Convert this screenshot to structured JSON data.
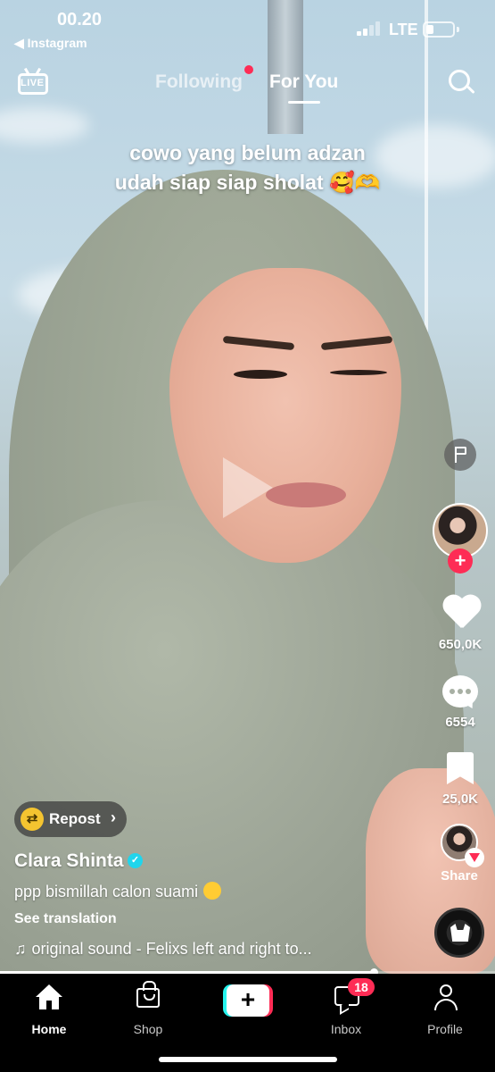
{
  "status_bar": {
    "time": "00.20",
    "back_app": "◀ Instagram",
    "network": "LTE",
    "battery_level": 0.3
  },
  "top_nav": {
    "live_label": "LIVE",
    "tabs": [
      {
        "label": "Following",
        "active": false,
        "has_dot": true
      },
      {
        "label": "For You",
        "active": true
      }
    ]
  },
  "video": {
    "caption_lines": [
      "cowo yang belum adzan",
      "udah siap siap sholat 🥰🫶"
    ],
    "progress": 0.755
  },
  "right_rail": {
    "likes": "650,0K",
    "comments": "6554",
    "saves": "25,0K",
    "share_label": "Share"
  },
  "post": {
    "repost_label": "Repost",
    "username": "Clara Shinta",
    "description": "ppp bismillah calon suami",
    "see_translation": "See translation",
    "sound": "original sound - Felixs  left  and  right  to..."
  },
  "tabbar": {
    "home": "Home",
    "shop": "Shop",
    "create": "+",
    "inbox": "Inbox",
    "inbox_badge": "18",
    "profile": "Profile"
  },
  "colors": {
    "accent_red": "#fe2c55",
    "accent_cyan": "#25f4ee",
    "verified_blue": "#20d5ec"
  },
  "icons": [
    "live-icon",
    "search-icon",
    "flag-icon",
    "heart-icon",
    "comment-icon",
    "bookmark-icon",
    "share-icon",
    "music-note-icon",
    "repost-icon",
    "verified-icon",
    "home-icon",
    "shop-bag-icon",
    "create-icon",
    "inbox-icon",
    "profile-icon"
  ]
}
